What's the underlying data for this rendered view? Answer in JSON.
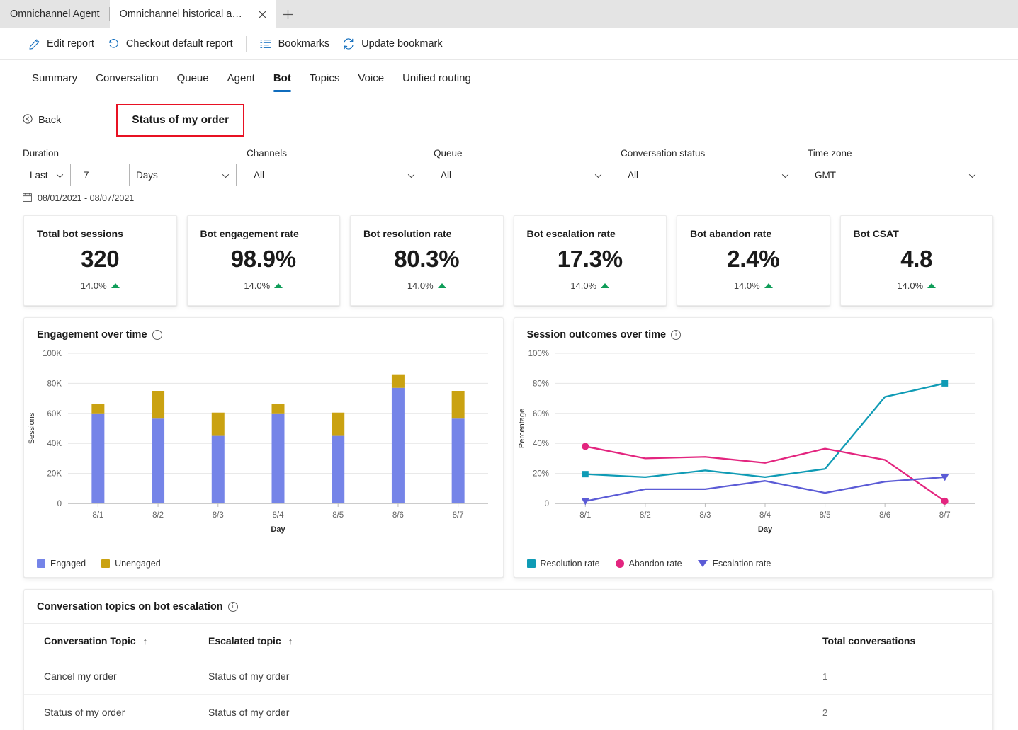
{
  "browser": {
    "tabs": [
      {
        "title": "Omnichannel Agent",
        "active": false
      },
      {
        "title": "Omnichannel historical ana...",
        "active": true
      }
    ],
    "close_icon": "close-icon",
    "new_tab_icon": "new-tab-icon"
  },
  "commandbar": {
    "items": [
      {
        "label": "Edit report",
        "icon": "pencil-icon"
      },
      {
        "label": "Checkout default report",
        "icon": "undo-arrow-icon"
      },
      {
        "label": "Bookmarks",
        "icon": "bookmark-list-icon"
      },
      {
        "label": "Update bookmark",
        "icon": "refresh-icon"
      }
    ]
  },
  "nav": {
    "tabs": [
      {
        "label": "Summary",
        "active": false
      },
      {
        "label": "Conversation",
        "active": false
      },
      {
        "label": "Queue",
        "active": false
      },
      {
        "label": "Agent",
        "active": false
      },
      {
        "label": "Bot",
        "active": true
      },
      {
        "label": "Topics",
        "active": false
      },
      {
        "label": "Voice",
        "active": false
      },
      {
        "label": "Unified routing",
        "active": false
      }
    ],
    "accent_color": "#0f6cbd"
  },
  "back": {
    "label": "Back",
    "icon": "back-circle-icon"
  },
  "report_title": {
    "text": "Status of my order",
    "highlight_color": "#e81123"
  },
  "filters": {
    "duration": {
      "label": "Duration",
      "relation": "Last",
      "amount": "7",
      "unit": "Days"
    },
    "channels": {
      "label": "Channels",
      "value": "All"
    },
    "queue": {
      "label": "Queue",
      "value": "All"
    },
    "conversation_status": {
      "label": "Conversation status",
      "value": "All"
    },
    "time_zone": {
      "label": "Time zone",
      "value": "GMT"
    },
    "date_range": {
      "text": "08/01/2021 - 08/07/2021",
      "icon": "calendar-icon"
    }
  },
  "kpis": [
    {
      "title": "Total bot sessions",
      "value": "320",
      "delta": "14.0%",
      "trend": "up"
    },
    {
      "title": "Bot engagement rate",
      "value": "98.9%",
      "delta": "14.0%",
      "trend": "up"
    },
    {
      "title": "Bot resolution rate",
      "value": "80.3%",
      "delta": "14.0%",
      "trend": "up"
    },
    {
      "title": "Bot escalation rate",
      "value": "17.3%",
      "delta": "14.0%",
      "trend": "up"
    },
    {
      "title": "Bot abandon rate",
      "value": "2.4%",
      "delta": "14.0%",
      "trend": "up"
    },
    {
      "title": "Bot CSAT",
      "value": "4.8",
      "delta": "14.0%",
      "trend": "up"
    }
  ],
  "chart_data": [
    {
      "type": "bar",
      "stacked": true,
      "title": "Engagement over time",
      "xlabel": "Day",
      "ylabel": "Sessions",
      "categories": [
        "8/1",
        "8/2",
        "8/3",
        "8/4",
        "8/5",
        "8/6",
        "8/7"
      ],
      "ytick_labels": [
        "0",
        "20K",
        "40K",
        "60K",
        "80K",
        "100K"
      ],
      "ytick_values": [
        0,
        20000,
        40000,
        60000,
        80000,
        100000
      ],
      "ylim": [
        0,
        100000
      ],
      "grid": true,
      "legend_position": "bottom-left",
      "series": [
        {
          "name": "Engaged",
          "color": "#7584e8",
          "values": [
            60000,
            56500,
            45000,
            60000,
            45000,
            77000,
            56500
          ]
        },
        {
          "name": "Unengaged",
          "color": "#caa211",
          "values": [
            6500,
            18500,
            15500,
            6500,
            15500,
            9000,
            18500
          ]
        }
      ]
    },
    {
      "type": "line",
      "title": "Session outcomes over time",
      "xlabel": "Day",
      "ylabel": "Percentage",
      "categories": [
        "8/1",
        "8/2",
        "8/3",
        "8/4",
        "8/5",
        "8/6",
        "8/7"
      ],
      "ytick_labels": [
        "0",
        "20%",
        "40%",
        "60%",
        "80%",
        "100%"
      ],
      "ytick_values": [
        0,
        20,
        40,
        60,
        80,
        100
      ],
      "ylim": [
        0,
        100
      ],
      "grid": true,
      "legend_position": "bottom-left",
      "series": [
        {
          "name": "Resolution rate",
          "color": "#0f9bb5",
          "marker": "square",
          "values": [
            19.5,
            17.5,
            22.0,
            17.5,
            23.0,
            71.0,
            80.0
          ]
        },
        {
          "name": "Abandon rate",
          "color": "#e3257f",
          "marker": "circle",
          "values": [
            38.0,
            30.0,
            31.0,
            27.0,
            36.5,
            29.0,
            1.5
          ]
        },
        {
          "name": "Escalation rate",
          "color": "#5b5bd6",
          "marker": "triangle-down",
          "values": [
            1.5,
            9.5,
            9.5,
            15.0,
            7.0,
            14.5,
            17.5
          ]
        }
      ]
    }
  ],
  "table": {
    "title": "Conversation topics on bot escalation",
    "columns": [
      {
        "label": "Conversation Topic",
        "sort": "↑"
      },
      {
        "label": "Escalated topic",
        "sort": "↑"
      },
      {
        "label": "Total conversations",
        "sort": ""
      }
    ],
    "rows": [
      {
        "topic": "Cancel my order",
        "escalated": "Status of my order",
        "total": "1"
      },
      {
        "topic": "Status of my order",
        "escalated": "Status of my order",
        "total": "2"
      }
    ]
  }
}
